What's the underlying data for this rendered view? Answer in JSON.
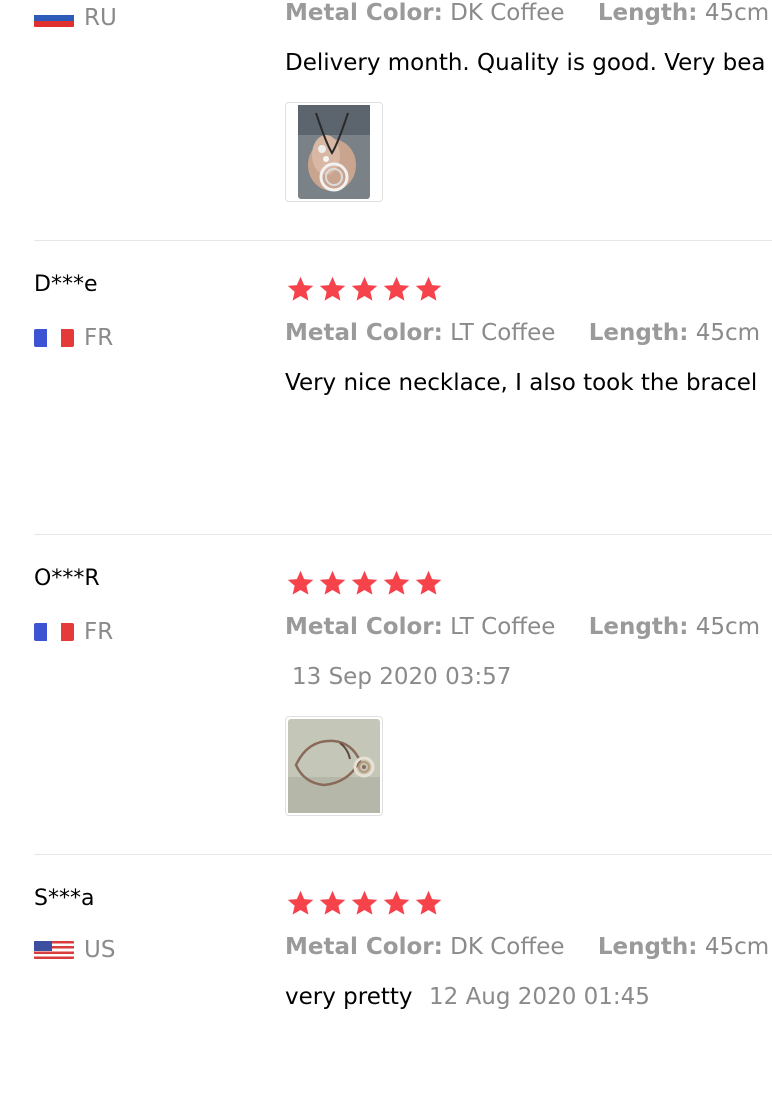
{
  "reviews": [
    {
      "name": "",
      "country": "RU",
      "flag": "russia-flag",
      "attributes": [
        {
          "label": "Metal Color:",
          "value": "DK Coffee"
        },
        {
          "label": "Length:",
          "value": "45cm"
        }
      ],
      "text": "Delivery month. Quality is good. Very bea",
      "date": "",
      "has_photo": true,
      "photo": "necklace-in-hand-photo"
    },
    {
      "name": "D***e",
      "country": "FR",
      "flag": "france-flag",
      "rating": 5,
      "attributes": [
        {
          "label": "Metal Color:",
          "value": "LT Coffee"
        },
        {
          "label": "Length:",
          "value": "45cm"
        }
      ],
      "text": "Very nice necklace, I also took the bracel",
      "date": "",
      "has_photo": false
    },
    {
      "name": "O***R",
      "country": "FR",
      "flag": "france-flag",
      "rating": 5,
      "attributes": [
        {
          "label": "Metal Color:",
          "value": "LT Coffee"
        },
        {
          "label": "Length:",
          "value": "45cm"
        }
      ],
      "text": "",
      "date": "13 Sep 2020 03:57",
      "has_photo": true,
      "photo": "necklace-on-table-photo"
    },
    {
      "name": "S***a",
      "country": "US",
      "flag": "usa-flag",
      "rating": 5,
      "attributes": [
        {
          "label": "Metal Color:",
          "value": "DK Coffee"
        },
        {
          "label": "Length:",
          "value": "45cm"
        }
      ],
      "text": "very pretty",
      "date": "12 Aug 2020 01:45",
      "has_photo": false
    }
  ],
  "colors": {
    "star": "#f5424b",
    "meta_text": "#8a8a8a",
    "divider": "#e6e6e6"
  }
}
